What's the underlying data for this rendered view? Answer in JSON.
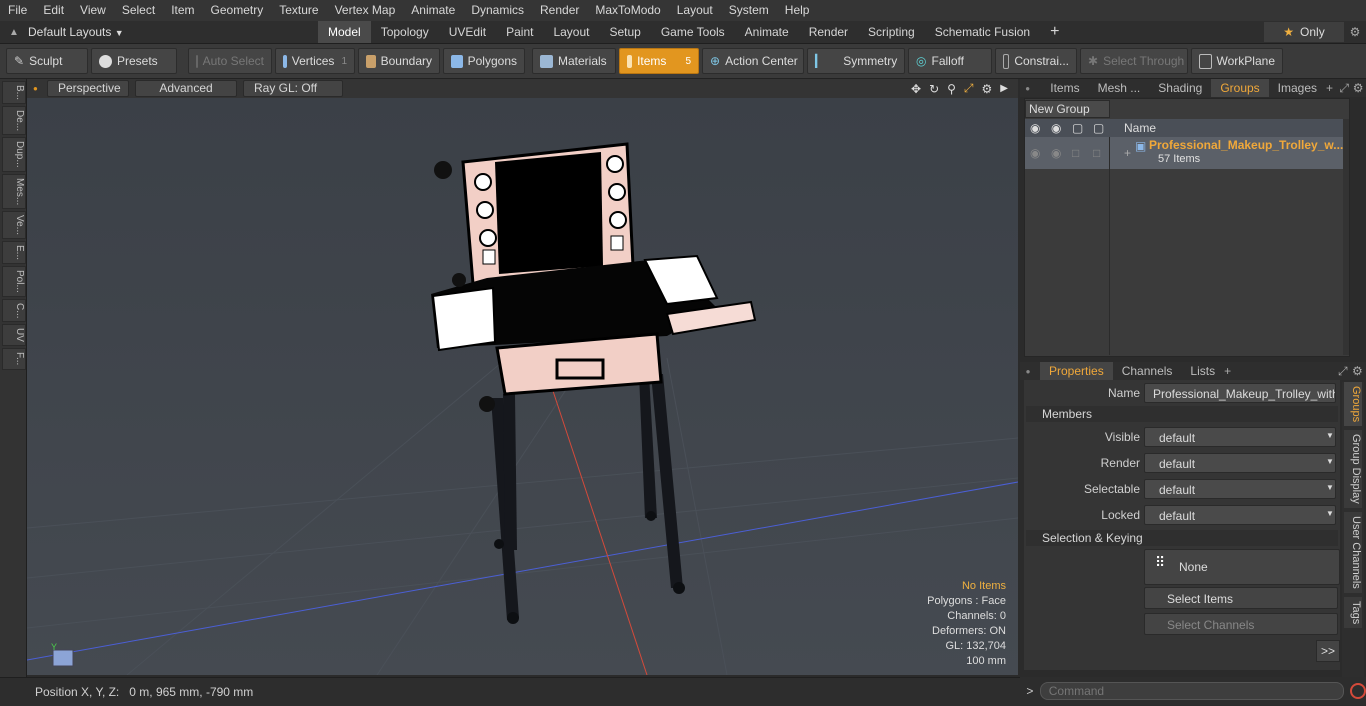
{
  "menu": [
    "File",
    "Edit",
    "View",
    "Select",
    "Item",
    "Geometry",
    "Texture",
    "Vertex Map",
    "Animate",
    "Dynamics",
    "Render",
    "MaxToModo",
    "Layout",
    "System",
    "Help"
  ],
  "layout": {
    "preset_label": "Default Layouts",
    "tabs": [
      "Model",
      "Topology",
      "UVEdit",
      "Paint",
      "Layout",
      "Setup",
      "Game Tools",
      "Animate",
      "Render",
      "Scripting",
      "Schematic Fusion"
    ],
    "active_tab": "Model",
    "add_symbol": "+",
    "only_label": "Only",
    "star_symbol": "★"
  },
  "toolbar": {
    "sculpt": "Sculpt",
    "presets": "Presets",
    "auto_select": "Auto Select",
    "vertices": "Vertices",
    "vertices_count": "1",
    "boundary": "Boundary",
    "polygons": "Polygons",
    "materials": "Materials",
    "items": "Items",
    "items_count": "5",
    "action_center": "Action Center",
    "symmetry": "Symmetry",
    "falloff": "Falloff",
    "constraints": "Constrai...",
    "select_through": "Select Through",
    "workplane": "WorkPlane"
  },
  "left_rail": [
    "B...",
    "De...",
    "Dup...",
    "Mes...",
    "Ve...",
    "E...",
    "Pol...",
    "C...",
    "UV",
    "F..."
  ],
  "viewport": {
    "perspective": "Perspective",
    "advanced": "Advanced",
    "raygl": "Ray GL: Off",
    "info": {
      "items": "No Items",
      "polygons": "Polygons : Face",
      "channels": "Channels: 0",
      "deformers": "Deformers: ON",
      "gl": "GL: 132,704",
      "scale": "100 mm"
    }
  },
  "status": {
    "position": "Position X, Y, Z:   0 m, 965 mm, -790 mm"
  },
  "panel_tabs": [
    "Items",
    "Mesh ...",
    "Shading",
    "Groups",
    "Images"
  ],
  "panel_active": "Groups",
  "groups": {
    "new_group": "New Group",
    "col_name": "Name",
    "item_name": "Professional_Makeup_Trolley_w...",
    "item_count": "57 Items"
  },
  "props_tabs": [
    "Properties",
    "Channels",
    "Lists"
  ],
  "props": {
    "name_label": "Name",
    "name_value": "Professional_Makeup_Trolley_with_Lig",
    "members": "Members",
    "visible_label": "Visible",
    "render_label": "Render",
    "selectable_label": "Selectable",
    "locked_label": "Locked",
    "default_value": "default",
    "sel_keying": "Selection & Keying",
    "none_label": "None",
    "select_items": "Select Items",
    "select_channels": "Select Channels",
    "more": ">>"
  },
  "side_tabs": [
    "Groups",
    "Group Display",
    "User Channels",
    "Tags"
  ],
  "command": {
    "prompt": ">",
    "placeholder": "Command"
  },
  "colors": {
    "accent": "#e2961f",
    "group_item": "#f0a83a",
    "info_highlight": "#f0b040"
  }
}
